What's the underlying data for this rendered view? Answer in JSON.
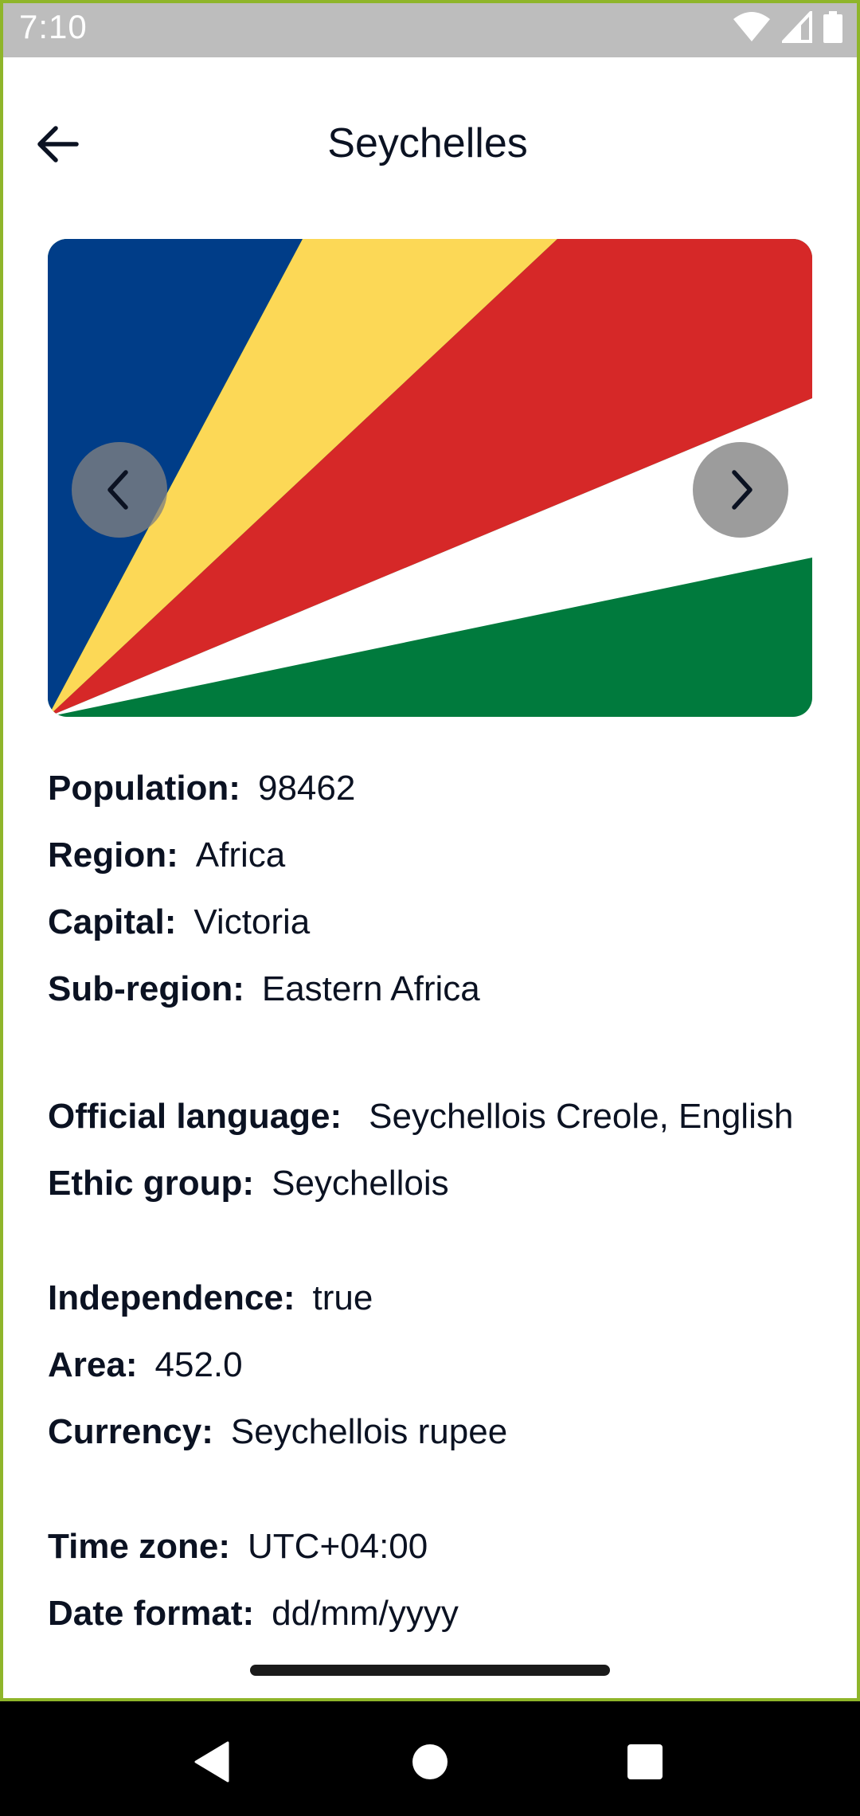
{
  "status_bar": {
    "time": "7:10"
  },
  "header": {
    "title": "Seychelles",
    "back_icon": "arrow-left-icon"
  },
  "flag": {
    "country": "Seychelles",
    "colors": {
      "blue": "#003d88",
      "yellow": "#fcd856",
      "red": "#d62828",
      "white": "#ffffff",
      "green": "#007a3d"
    },
    "prev_icon": "chevron-left-icon",
    "next_icon": "chevron-right-icon"
  },
  "details": {
    "population": {
      "label": "Population:",
      "value": "98462"
    },
    "region": {
      "label": "Region:",
      "value": "Africa"
    },
    "capital": {
      "label": "Capital:",
      "value": "Victoria"
    },
    "subregion": {
      "label": "Sub-region:",
      "value": "Eastern Africa"
    },
    "official_language": {
      "label": "Official language:",
      "value": "Seychellois Creole, English"
    },
    "ethnic_group": {
      "label": "Ethic group:",
      "value": "Seychellois"
    },
    "independence": {
      "label": "Independence:",
      "value": "true"
    },
    "area": {
      "label": "Area:",
      "value": "452.0"
    },
    "currency": {
      "label": "Currency:",
      "value": "Seychellois rupee"
    },
    "time_zone": {
      "label": "Time zone:",
      "value": "UTC+04:00"
    },
    "date_format": {
      "label": "Date format:",
      "value": "dd/mm/yyyy"
    }
  },
  "system_nav": {
    "back_icon": "triangle-back-icon",
    "home_icon": "circle-home-icon",
    "recents_icon": "square-recents-icon"
  }
}
